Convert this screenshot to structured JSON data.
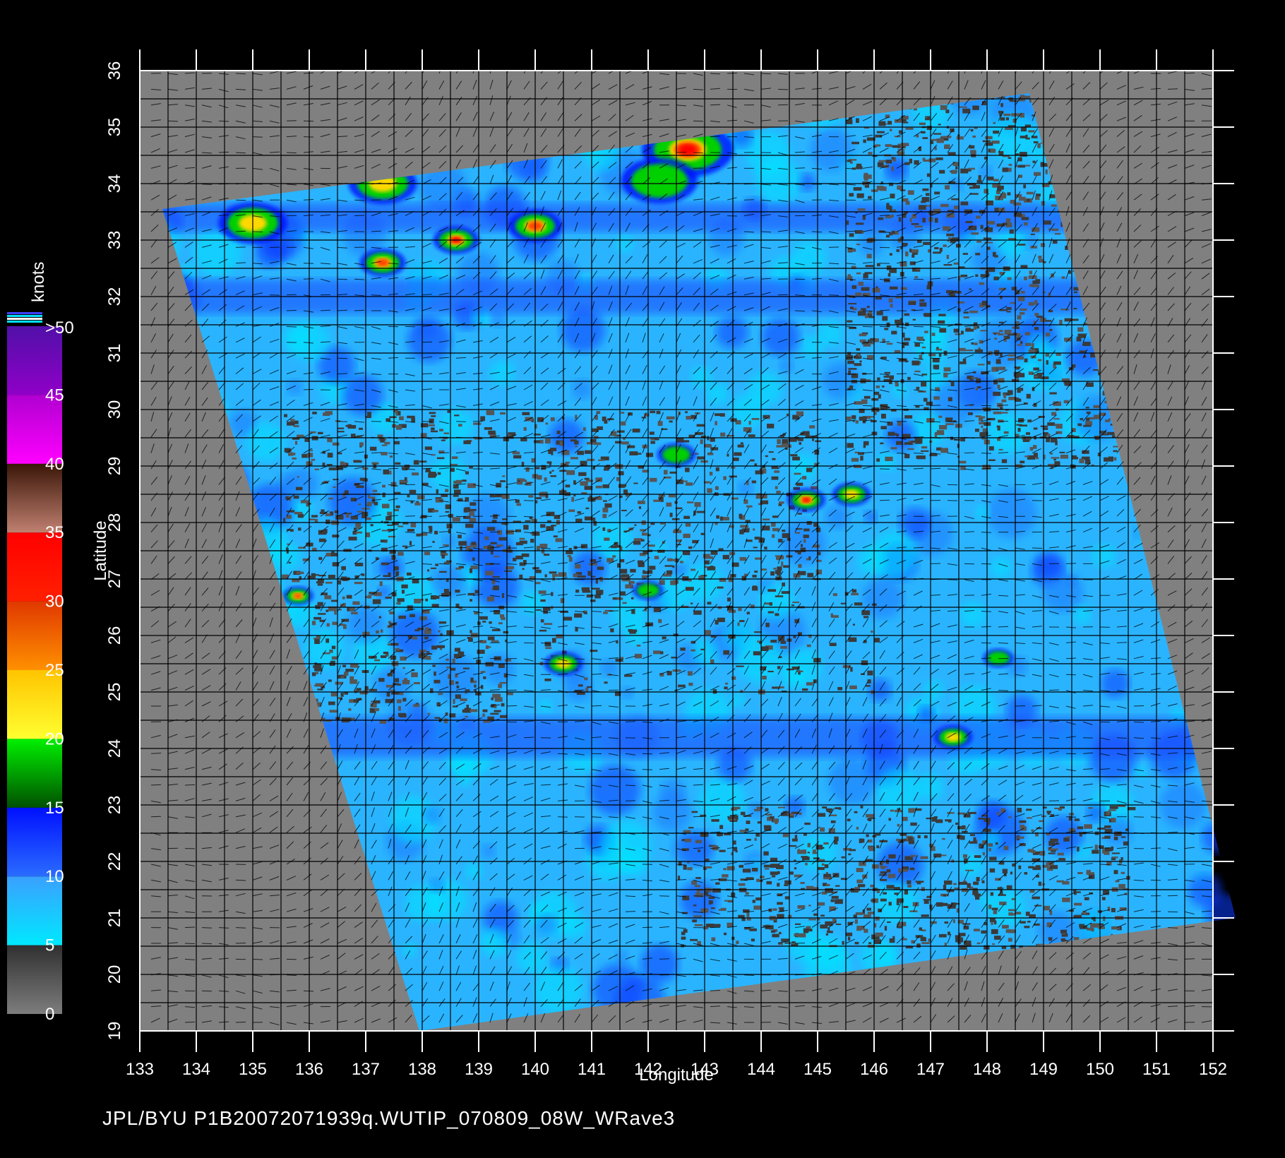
{
  "map": {
    "x_axis_label": "Longitude",
    "y_axis_label": "Latitude",
    "lon_ticks": [
      133,
      134,
      135,
      136,
      137,
      138,
      139,
      140,
      141,
      142,
      143,
      144,
      145,
      146,
      147,
      148,
      149,
      150,
      151,
      152
    ],
    "lat_ticks": [
      19,
      20,
      21,
      22,
      23,
      24,
      25,
      26,
      27,
      28,
      29,
      30,
      31,
      32,
      33,
      34,
      35,
      36
    ],
    "lon_range": [
      133,
      152
    ],
    "lat_range": [
      19,
      36
    ],
    "land_color": "#808080",
    "grid_color": "#000000"
  },
  "colorbar": {
    "unit_label": "knots",
    "tick_labels": [
      "0",
      "5",
      "10",
      "15",
      "20",
      "25",
      "30",
      "35",
      "40",
      "45",
      ">50"
    ],
    "bands": [
      {
        "from": 0,
        "to": 5,
        "colors": [
          "#7d7d7d",
          "#303030"
        ]
      },
      {
        "from": 5,
        "to": 10,
        "colors": [
          "#00e8ff",
          "#3aa0ff"
        ]
      },
      {
        "from": 10,
        "to": 15,
        "colors": [
          "#2a6cff",
          "#0010ff"
        ]
      },
      {
        "from": 15,
        "to": 20,
        "colors": [
          "#005000",
          "#00f000"
        ]
      },
      {
        "from": 20,
        "to": 25,
        "colors": [
          "#ffff30",
          "#ffc400"
        ]
      },
      {
        "from": 25,
        "to": 30,
        "colors": [
          "#ff9000",
          "#e03800"
        ]
      },
      {
        "from": 30,
        "to": 35,
        "colors": [
          "#ff2000",
          "#ff0000"
        ]
      },
      {
        "from": 35,
        "to": 40,
        "colors": [
          "#c08070",
          "#3a1608"
        ]
      },
      {
        "from": 40,
        "to": 45,
        "colors": [
          "#ff00ff",
          "#b000d0"
        ]
      },
      {
        "from": 45,
        "to": 50,
        "colors": [
          "#9000c8",
          "#5010a8"
        ]
      }
    ]
  },
  "swath": {
    "corners_lonlat": [
      [
        133.4,
        33.55
      ],
      [
        148.75,
        35.6
      ],
      [
        152.4,
        21.0
      ],
      [
        137.95,
        19.0
      ]
    ]
  },
  "wind_features": [
    {
      "lon": 135.0,
      "lat": 33.3,
      "speed": 20,
      "r": 0.45
    },
    {
      "lon": 137.3,
      "lat": 34.0,
      "speed": 20,
      "r": 0.45
    },
    {
      "lon": 142.7,
      "lat": 34.6,
      "speed": 30,
      "r": 0.6
    },
    {
      "lon": 142.2,
      "lat": 34.05,
      "speed": 18,
      "r": 0.5
    },
    {
      "lon": 140.0,
      "lat": 33.25,
      "speed": 25,
      "r": 0.35
    },
    {
      "lon": 138.6,
      "lat": 33.0,
      "speed": 30,
      "r": 0.3
    },
    {
      "lon": 137.3,
      "lat": 32.6,
      "speed": 25,
      "r": 0.3
    },
    {
      "lon": 144.8,
      "lat": 28.4,
      "speed": 30,
      "r": 0.25
    },
    {
      "lon": 145.6,
      "lat": 28.5,
      "speed": 22,
      "r": 0.25
    },
    {
      "lon": 142.5,
      "lat": 29.2,
      "speed": 18,
      "r": 0.25
    },
    {
      "lon": 135.8,
      "lat": 26.7,
      "speed": 25,
      "r": 0.2
    },
    {
      "lon": 147.4,
      "lat": 24.2,
      "speed": 22,
      "r": 0.25
    },
    {
      "lon": 148.2,
      "lat": 25.6,
      "speed": 18,
      "r": 0.2
    },
    {
      "lon": 142.0,
      "lat": 26.8,
      "speed": 18,
      "r": 0.2
    },
    {
      "lon": 140.5,
      "lat": 25.5,
      "speed": 20,
      "r": 0.25
    }
  ],
  "footer": {
    "text": "JPL/BYU  P1B20072071939q.WUTIP_070809_08W_WRave3"
  }
}
